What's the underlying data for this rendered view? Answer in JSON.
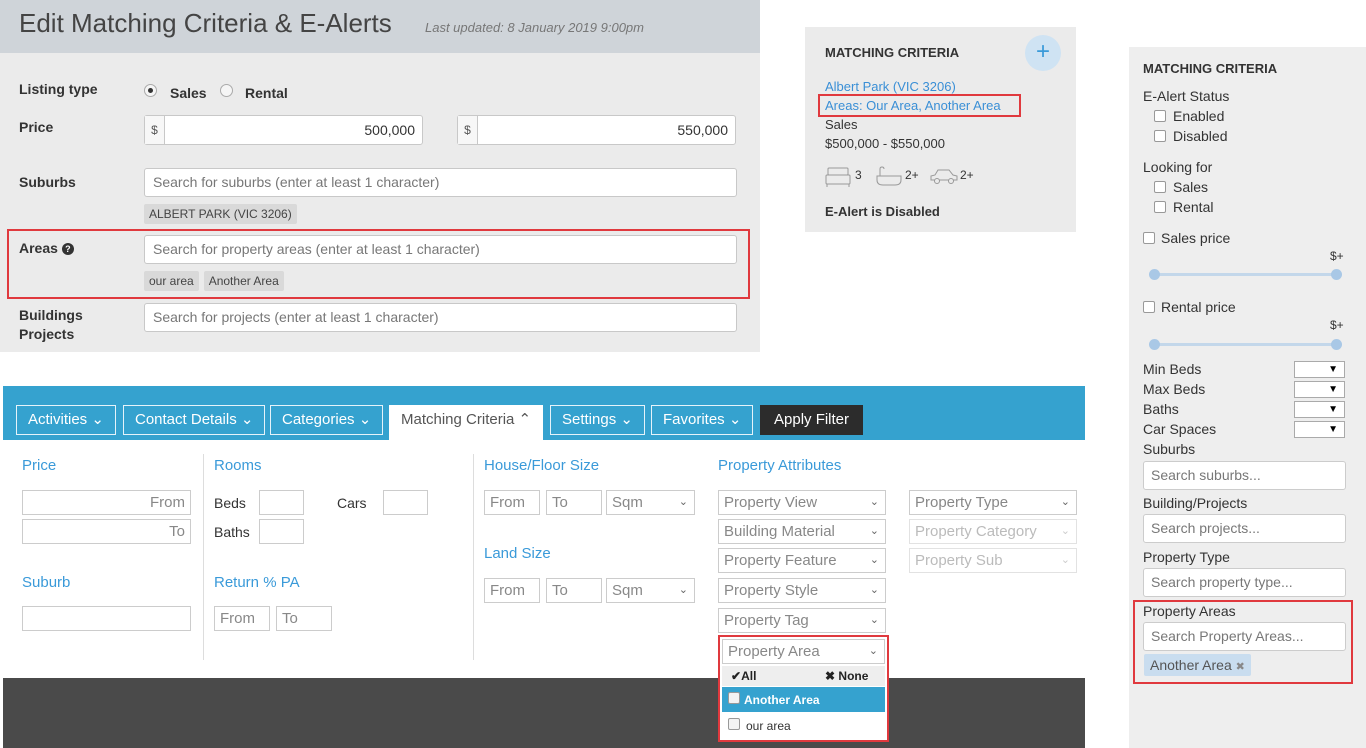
{
  "edit_panel": {
    "title": "Edit Matching Criteria & E-Alerts",
    "last_updated": "Last updated: 8 January 2019 9:00pm",
    "listing_type_label": "Listing type",
    "sales_option": "Sales",
    "rental_option": "Rental",
    "selected_listing_type": "Sales",
    "price_label": "Price",
    "currency": "$",
    "price_min": "500,000",
    "price_max": "550,000",
    "suburbs_label": "Suburbs",
    "suburbs_placeholder": "Search for suburbs (enter at least 1 character)",
    "suburb_tags": [
      "ALBERT PARK (VIC 3206)"
    ],
    "areas_label": "Areas",
    "areas_placeholder": "Search for property areas (enter at least 1 character)",
    "area_tags": [
      "our area",
      "Another Area"
    ],
    "buildings_label_1": "Buildings",
    "buildings_label_2": "Projects",
    "projects_placeholder": "Search for projects (enter at least 1 character)"
  },
  "criteria_card": {
    "heading": "MATCHING CRITERIA",
    "plus_icon": "+",
    "suburb_link": "Albert Park (VIC 3206)",
    "areas_link": "Areas: Our Area, Another Area",
    "listing_type": "Sales",
    "price_range": "$500,000 - $550,000",
    "beds": "3",
    "baths": "2+",
    "cars": "2+",
    "ealert_status": "E-Alert is Disabled"
  },
  "filter_bar": {
    "tabs": [
      "Activities",
      "Contact Details",
      "Categories",
      "Matching Criteria",
      "Settings",
      "Favorites"
    ],
    "active_tab": "Matching Criteria",
    "apply_button": "Apply Filter",
    "price_title": "Price",
    "from_placeholder": "From",
    "to_placeholder": "To",
    "rooms_title": "Rooms",
    "beds_label": "Beds",
    "cars_label": "Cars",
    "baths_label": "Baths",
    "suburb_title": "Suburb",
    "return_title": "Return % PA",
    "house_size_title": "House/Floor Size",
    "land_size_title": "Land Size",
    "unit": "Sqm",
    "attributes_title": "Property Attributes",
    "attribute_dropdowns": [
      "Property View",
      "Building Material",
      "Property Feature",
      "Property Style",
      "Property Tag",
      "Property Area"
    ],
    "type_dropdowns": [
      "Property Type",
      "Property Category",
      "Property Sub"
    ],
    "area_dropdown": {
      "all_label": "All",
      "none_label": "None",
      "options": [
        "Another Area",
        "our area"
      ],
      "highlighted": "Another Area"
    }
  },
  "sidebar": {
    "heading": "MATCHING CRITERIA",
    "ealert_status_label": "E-Alert Status",
    "enabled_label": "Enabled",
    "disabled_label": "Disabled",
    "looking_for_label": "Looking for",
    "sales_label": "Sales",
    "rental_label": "Rental",
    "sales_price_label": "Sales price",
    "rental_price_label": "Rental price",
    "slider_max_label": "$+",
    "min_beds_label": "Min Beds",
    "max_beds_label": "Max Beds",
    "baths_label": "Baths",
    "car_spaces_label": "Car Spaces",
    "suburbs_label": "Suburbs",
    "suburbs_placeholder": "Search suburbs...",
    "building_projects_label": "Building/Projects",
    "projects_placeholder": "Search projects...",
    "property_type_label": "Property Type",
    "property_type_placeholder": "Search property type...",
    "property_areas_label": "Property Areas",
    "property_areas_placeholder": "Search Property Areas...",
    "area_chip": "Another Area"
  },
  "colors": {
    "accent_blue": "#35a2cf",
    "link_blue": "#3a8fd6",
    "highlight_red": "#e0393e"
  }
}
